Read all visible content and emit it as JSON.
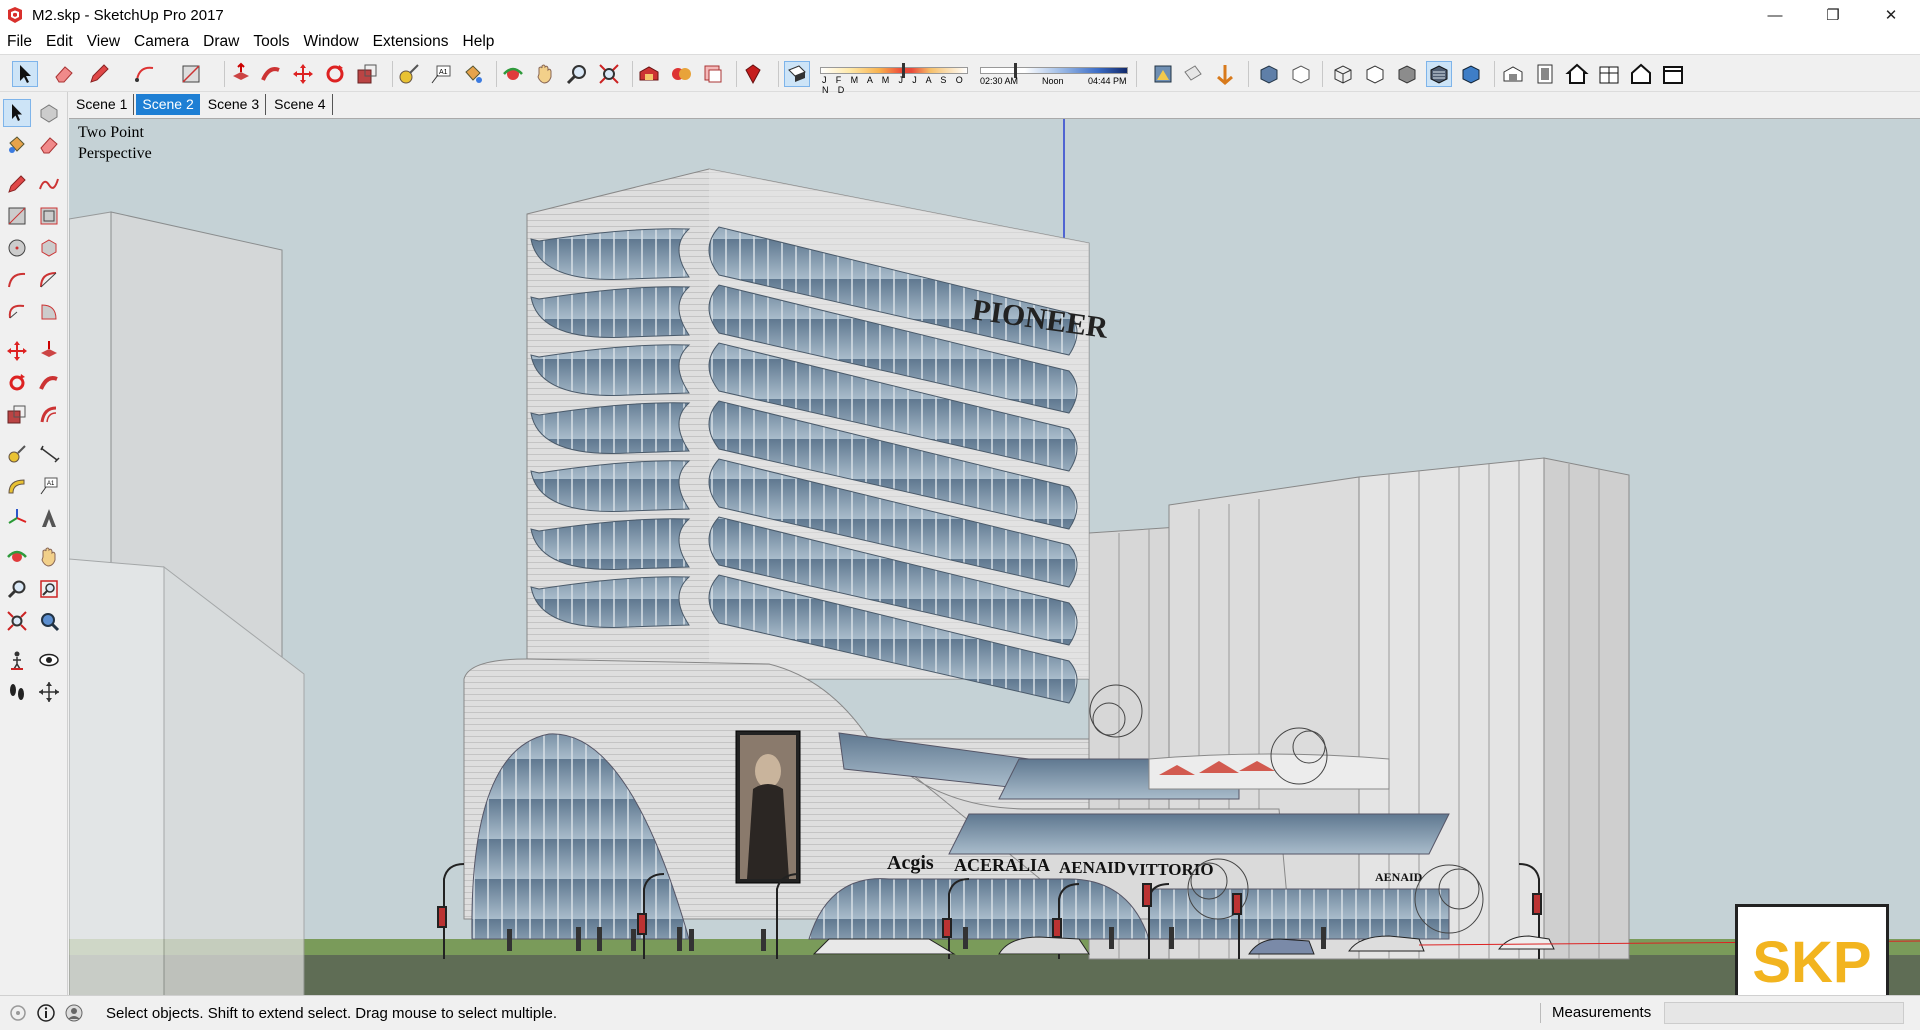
{
  "window": {
    "title": "M2.skp - SketchUp Pro 2017",
    "controls": {
      "minimize": "—",
      "maximize": "❐",
      "close": "✕"
    }
  },
  "menu": [
    "File",
    "Edit",
    "View",
    "Camera",
    "Draw",
    "Tools",
    "Window",
    "Extensions",
    "Help"
  ],
  "shadows": {
    "months_label": "J F M A M J J A S O N D",
    "time_start": "02:30 AM",
    "time_mid": "Noon",
    "time_end": "04:44 PM"
  },
  "scenes": [
    {
      "label": "Scene 1",
      "active": false
    },
    {
      "label": "Scene 2",
      "active": true
    },
    {
      "label": "Scene 3",
      "active": false
    },
    {
      "label": "Scene 4",
      "active": false
    }
  ],
  "viewport": {
    "camera_line1": "Two Point",
    "camera_line2": "Perspective",
    "sky_color": "#c5d2d6",
    "ground_color": "#7a9b5a",
    "building_sign": "PIONEER",
    "store_signs": [
      "Acgis",
      "ACERALIA",
      "AENAID",
      "VITTORIO",
      "AENAID"
    ]
  },
  "watermark": {
    "text": "SKP",
    "color": "#f2b41f"
  },
  "status": {
    "message": "Select objects. Shift to extend select. Drag mouse to select multiple.",
    "measurements_label": "Measurements",
    "measurements_value": ""
  },
  "icons": {
    "toolbar": [
      "select-icon",
      "eraser-icon",
      "pencil-line-icon",
      "arc-icon",
      "rectangle-icon",
      "push-pull-icon",
      "follow-me-icon",
      "move-icon",
      "rotate-icon",
      "scale-icon",
      "tape-measure-icon",
      "text-icon",
      "paint-bucket-icon",
      "orbit-icon",
      "pan-icon",
      "zoom-icon",
      "zoom-extents-icon",
      "warehouse-icon",
      "extension-warehouse-icon",
      "layout-icon",
      "ruby-icon",
      "shadows-toggle-icon",
      "styles-icon",
      "view-iso-icon",
      "view-top-icon",
      "view-front-icon",
      "view-right-icon",
      "view-back-icon",
      "view-left-icon"
    ]
  }
}
